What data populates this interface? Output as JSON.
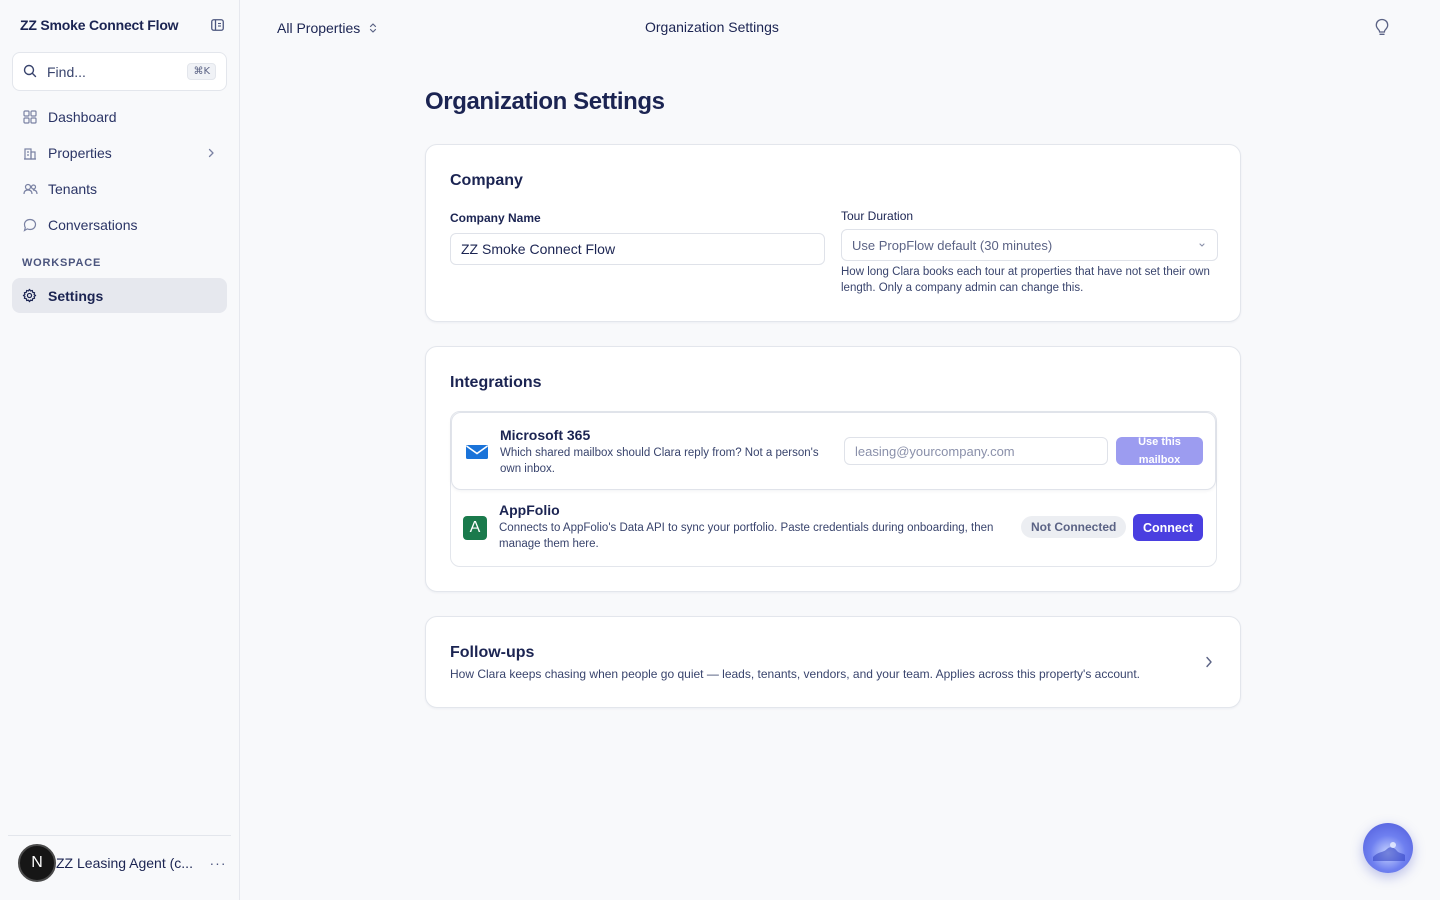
{
  "sidebar": {
    "brand": "ZZ Smoke Connect Flow",
    "search": {
      "placeholder": "Find...",
      "shortcut": "⌘K"
    },
    "items": [
      {
        "label": "Dashboard",
        "icon": "grid-icon"
      },
      {
        "label": "Properties",
        "icon": "building-icon"
      },
      {
        "label": "Tenants",
        "icon": "users-icon"
      },
      {
        "label": "Conversations",
        "icon": "chat-icon"
      }
    ],
    "section": "WORKSPACE",
    "settings": {
      "label": "Settings",
      "icon": "gear-icon"
    },
    "user": {
      "initial": "N",
      "name": "ZZ Leasing Agent (c..."
    }
  },
  "topbar": {
    "property_selector": "All Properties",
    "title": "Organization Settings"
  },
  "page": {
    "title": "Organization Settings"
  },
  "company": {
    "title": "Company",
    "name_label": "Company Name",
    "name_value": "ZZ Smoke Connect Flow",
    "tour_label": "Tour Duration",
    "tour_value": "Use PropFlow default (30 minutes)",
    "tour_help": "How long Clara books each tour at properties that have not set their own length. Only a company admin can change this."
  },
  "integrations": {
    "title": "Integrations",
    "microsoft": {
      "name": "Microsoft 365",
      "desc": "Which shared mailbox should Clara reply from? Not a person's own inbox.",
      "placeholder": "leasing@yourcompany.com",
      "button": "Use this mailbox"
    },
    "appfolio": {
      "name": "AppFolio",
      "logo": "A",
      "desc": "Connects to AppFolio's Data API to sync your portfolio. Paste credentials during onboarding, then manage them here.",
      "status": "Not Connected",
      "button": "Connect"
    }
  },
  "followups": {
    "title": "Follow-ups",
    "desc": "How Clara keeps chasing when people go quiet — leads, tenants, vendors, and your team. Applies across this property's account."
  },
  "colors": {
    "accent": "#4a3fe0",
    "accent_muted": "#9c9cf0",
    "text": "#1b2452",
    "appfolio_green": "#1a7a4c"
  }
}
